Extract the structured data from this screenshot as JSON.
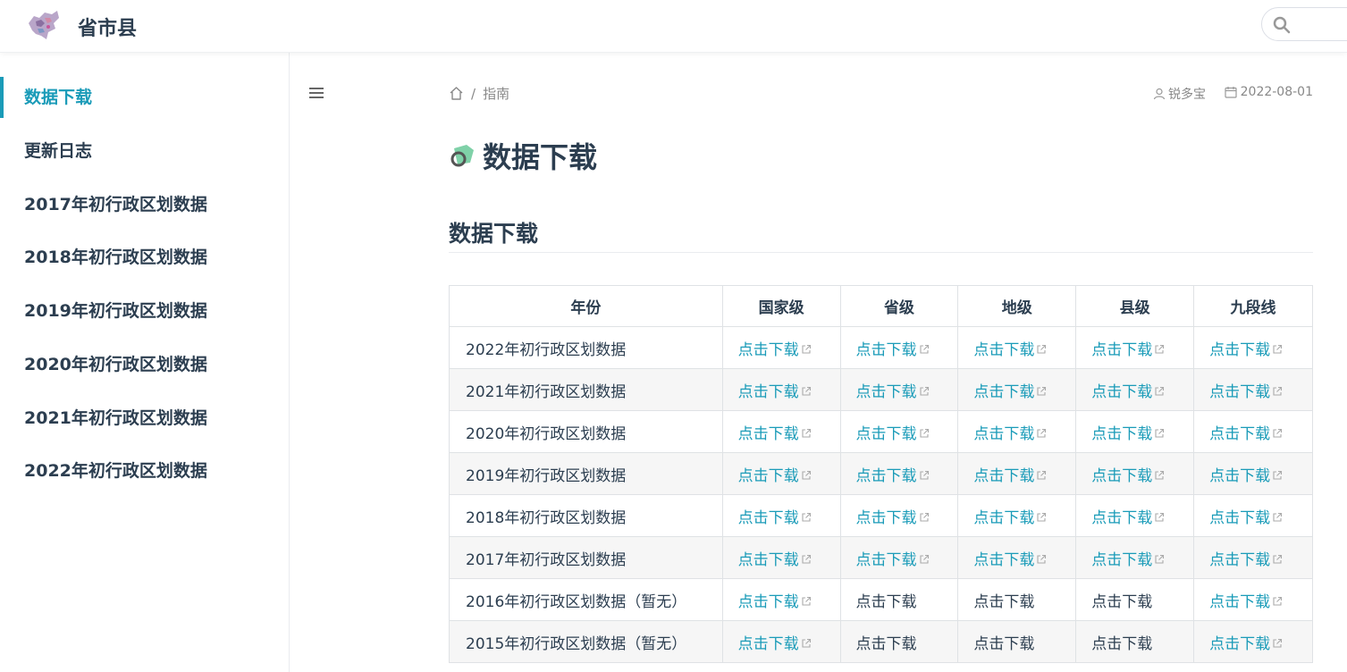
{
  "header": {
    "site_title": "省市县",
    "logo_icon": "china-map-logo",
    "search_icon": "search-icon"
  },
  "sidebar": {
    "items": [
      {
        "label": "数据下载",
        "active": true
      },
      {
        "label": "更新日志",
        "active": false
      },
      {
        "label": "2017年初行政区划数据",
        "active": false
      },
      {
        "label": "2018年初行政区划数据",
        "active": false
      },
      {
        "label": "2019年初行政区划数据",
        "active": false
      },
      {
        "label": "2020年初行政区划数据",
        "active": false
      },
      {
        "label": "2021年初行政区划数据",
        "active": false
      },
      {
        "label": "2022年初行政区划数据",
        "active": false
      }
    ]
  },
  "breadcrumb": {
    "home_icon": "home-icon",
    "separator": "/",
    "current": "指南"
  },
  "meta": {
    "author": "锐多宝",
    "date": "2022-08-01"
  },
  "page": {
    "title": "数据下载",
    "section_heading": "数据下载"
  },
  "table": {
    "headers": [
      "年份",
      "国家级",
      "省级",
      "地级",
      "县级",
      "九段线"
    ],
    "rows": [
      {
        "name": "2022年初行政区划数据",
        "cells": [
          {
            "text": "点击下载",
            "link": true
          },
          {
            "text": "点击下载",
            "link": true
          },
          {
            "text": "点击下载",
            "link": true
          },
          {
            "text": "点击下载",
            "link": true
          },
          {
            "text": "点击下载",
            "link": true
          }
        ]
      },
      {
        "name": "2021年初行政区划数据",
        "cells": [
          {
            "text": "点击下载",
            "link": true
          },
          {
            "text": "点击下载",
            "link": true
          },
          {
            "text": "点击下载",
            "link": true
          },
          {
            "text": "点击下载",
            "link": true
          },
          {
            "text": "点击下载",
            "link": true
          }
        ]
      },
      {
        "name": "2020年初行政区划数据",
        "cells": [
          {
            "text": "点击下载",
            "link": true
          },
          {
            "text": "点击下载",
            "link": true
          },
          {
            "text": "点击下载",
            "link": true
          },
          {
            "text": "点击下载",
            "link": true
          },
          {
            "text": "点击下载",
            "link": true
          }
        ]
      },
      {
        "name": "2019年初行政区划数据",
        "cells": [
          {
            "text": "点击下载",
            "link": true
          },
          {
            "text": "点击下载",
            "link": true
          },
          {
            "text": "点击下载",
            "link": true
          },
          {
            "text": "点击下载",
            "link": true
          },
          {
            "text": "点击下载",
            "link": true
          }
        ]
      },
      {
        "name": "2018年初行政区划数据",
        "cells": [
          {
            "text": "点击下载",
            "link": true
          },
          {
            "text": "点击下载",
            "link": true
          },
          {
            "text": "点击下载",
            "link": true
          },
          {
            "text": "点击下载",
            "link": true
          },
          {
            "text": "点击下载",
            "link": true
          }
        ]
      },
      {
        "name": "2017年初行政区划数据",
        "cells": [
          {
            "text": "点击下载",
            "link": true
          },
          {
            "text": "点击下载",
            "link": true
          },
          {
            "text": "点击下载",
            "link": true
          },
          {
            "text": "点击下载",
            "link": true
          },
          {
            "text": "点击下载",
            "link": true
          }
        ]
      },
      {
        "name": "2016年初行政区划数据（暂无）",
        "cells": [
          {
            "text": "点击下载",
            "link": true
          },
          {
            "text": "点击下载",
            "link": false
          },
          {
            "text": "点击下载",
            "link": false
          },
          {
            "text": "点击下载",
            "link": false
          },
          {
            "text": "点击下载",
            "link": true
          }
        ]
      },
      {
        "name": "2015年初行政区划数据（暂无）",
        "cells": [
          {
            "text": "点击下载",
            "link": true
          },
          {
            "text": "点击下载",
            "link": false
          },
          {
            "text": "点击下载",
            "link": false
          },
          {
            "text": "点击下载",
            "link": false
          },
          {
            "text": "点击下载",
            "link": true
          }
        ]
      }
    ]
  },
  "colors": {
    "accent": "#1a9bb8",
    "text": "#2c3e50",
    "muted": "#888888",
    "stripe": "#f6f6f6"
  }
}
